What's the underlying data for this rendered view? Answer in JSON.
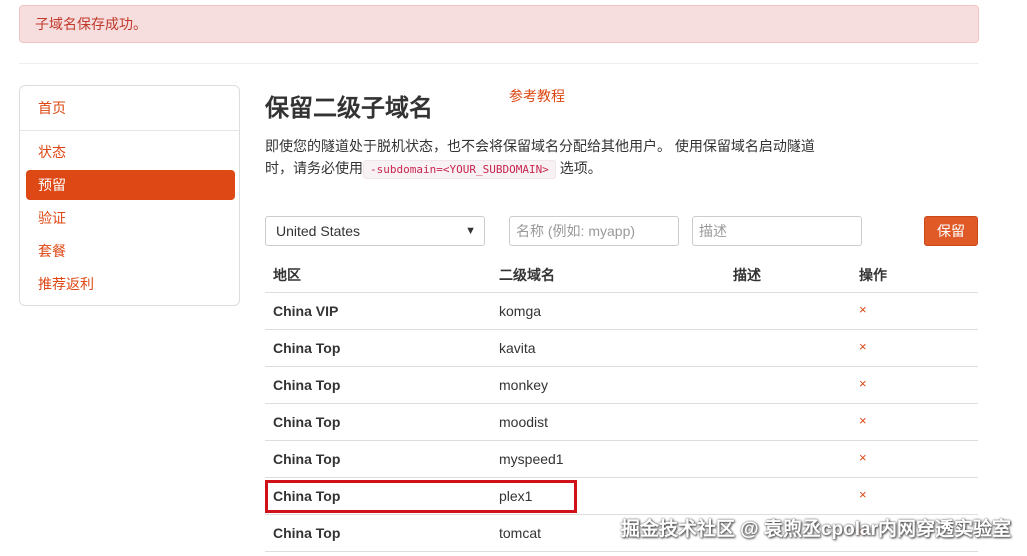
{
  "alert": {
    "message": "子域名保存成功。"
  },
  "sidebar": {
    "items": [
      {
        "label": "首页",
        "active": false
      },
      {
        "label": "状态",
        "active": false
      },
      {
        "label": "预留",
        "active": true
      },
      {
        "label": "验证",
        "active": false
      },
      {
        "label": "套餐",
        "active": false
      },
      {
        "label": "推荐返利",
        "active": false
      }
    ]
  },
  "main": {
    "title": "保留二级子域名",
    "reference_link": "参考教程",
    "description_part1": "即使您的隧道处于脱机状态，也不会将保留域名分配给其他用户。 使用保留域名启动隧道时，请务必使用",
    "description_code": "-subdomain=<YOUR_SUBDOMAIN>",
    "description_part2": "选项。"
  },
  "form": {
    "region_selected": "United States",
    "name_placeholder": "名称 (例如: myapp)",
    "description_placeholder": "描述",
    "submit_label": "保留"
  },
  "table": {
    "headers": [
      "地区",
      "二级域名",
      "描述",
      "操作"
    ],
    "rows": [
      {
        "region": "China VIP",
        "subdomain": "komga",
        "description": "",
        "action": "×"
      },
      {
        "region": "China Top",
        "subdomain": "kavita",
        "description": "",
        "action": "×"
      },
      {
        "region": "China Top",
        "subdomain": "monkey",
        "description": "",
        "action": "×"
      },
      {
        "region": "China Top",
        "subdomain": "moodist",
        "description": "",
        "action": "×"
      },
      {
        "region": "China Top",
        "subdomain": "myspeed1",
        "description": "",
        "action": "×"
      },
      {
        "region": "China Top",
        "subdomain": "plex1",
        "description": "",
        "action": "×"
      },
      {
        "region": "China Top",
        "subdomain": "tomcat",
        "description": "",
        "action": "×"
      }
    ]
  },
  "watermark": "掘金技术社区 @ 袁煦丞cpolar内网穿透实验室",
  "colors": {
    "accent": "#dd4814",
    "alert_bg": "#f7dede",
    "highlight": "#d0111a"
  }
}
